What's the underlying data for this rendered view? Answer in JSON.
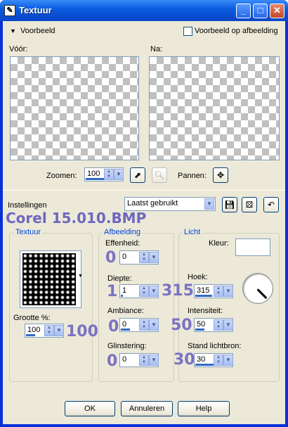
{
  "window": {
    "title": "Textuur"
  },
  "preview": {
    "toggle_label": "Voorbeeld",
    "on_image_label": "Voorbeeld op afbeelding",
    "before_label": "Vóór:",
    "after_label": "Na:",
    "zoom_label": "Zoomen:",
    "zoom_value": "100",
    "pan_label": "Pannen:"
  },
  "settings": {
    "label": "Instellingen",
    "preset_value": "Laatst gebruikt"
  },
  "overlay": {
    "title": "Corel 15.010.BMP",
    "effenheid": "0",
    "diepte": "1",
    "ambiance": "0",
    "glinstering": "0",
    "grootte": "100",
    "hoek": "315",
    "intensiteit": "50",
    "stand": "30"
  },
  "texture": {
    "group_label": "Textuur",
    "size_label": "Grootte %:",
    "size_value": "100"
  },
  "appearance": {
    "group_label": "Afbeelding",
    "effenheid_label": "Effenheid:",
    "effenheid_value": "0",
    "diepte_label": "Diepte:",
    "diepte_value": "1",
    "ambiance_label": "Ambiance:",
    "ambiance_value": "0",
    "glinstering_label": "Glinstering:",
    "glinstering_value": "0"
  },
  "light": {
    "group_label": "Licht",
    "color_label": "Kleur:",
    "hoek_label": "Hoek:",
    "hoek_value": "315",
    "intensiteit_label": "Intensiteit:",
    "intensiteit_value": "50",
    "stand_label": "Stand lichtbron:",
    "stand_value": "30"
  },
  "buttons": {
    "ok": "OK",
    "cancel": "Annuleren",
    "help": "Help"
  }
}
